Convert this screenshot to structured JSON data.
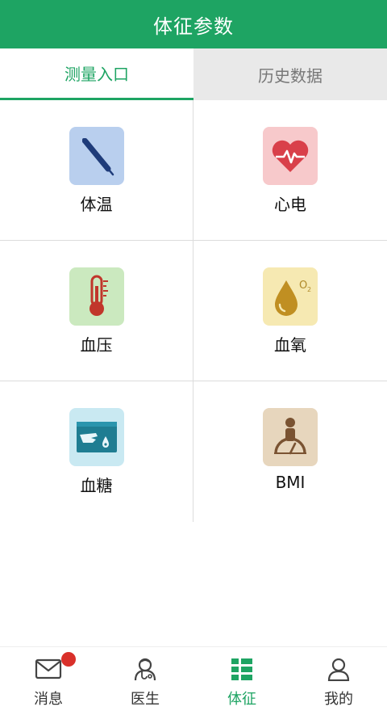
{
  "header": {
    "title": "体征参数"
  },
  "tabs": [
    {
      "label": "测量入口",
      "active": true
    },
    {
      "label": "历史数据",
      "active": false
    }
  ],
  "grid": [
    {
      "label": "体温",
      "icon": "thermometer-probe-icon",
      "bg": "#b9cfee"
    },
    {
      "label": "心电",
      "icon": "heart-ecg-icon",
      "bg": "#f7c9cb"
    },
    {
      "label": "血压",
      "icon": "thermometer-icon",
      "bg": "#cbe9bf"
    },
    {
      "label": "血氧",
      "icon": "drop-o2-icon",
      "bg": "#f6e9b2"
    },
    {
      "label": "血糖",
      "icon": "glucose-meter-icon",
      "bg": "#c9e9f2"
    },
    {
      "label": "BMI",
      "icon": "person-scale-icon",
      "bg": "#e7d6bd"
    }
  ],
  "tabbar": [
    {
      "label": "消息",
      "icon": "mail-icon",
      "badge": true
    },
    {
      "label": "医生",
      "icon": "doctor-icon"
    },
    {
      "label": "体征",
      "icon": "vitals-icon",
      "active": true
    },
    {
      "label": "我的",
      "icon": "user-icon"
    }
  ],
  "colors": {
    "brand": "#1ea463",
    "badge": "#d9302a"
  }
}
